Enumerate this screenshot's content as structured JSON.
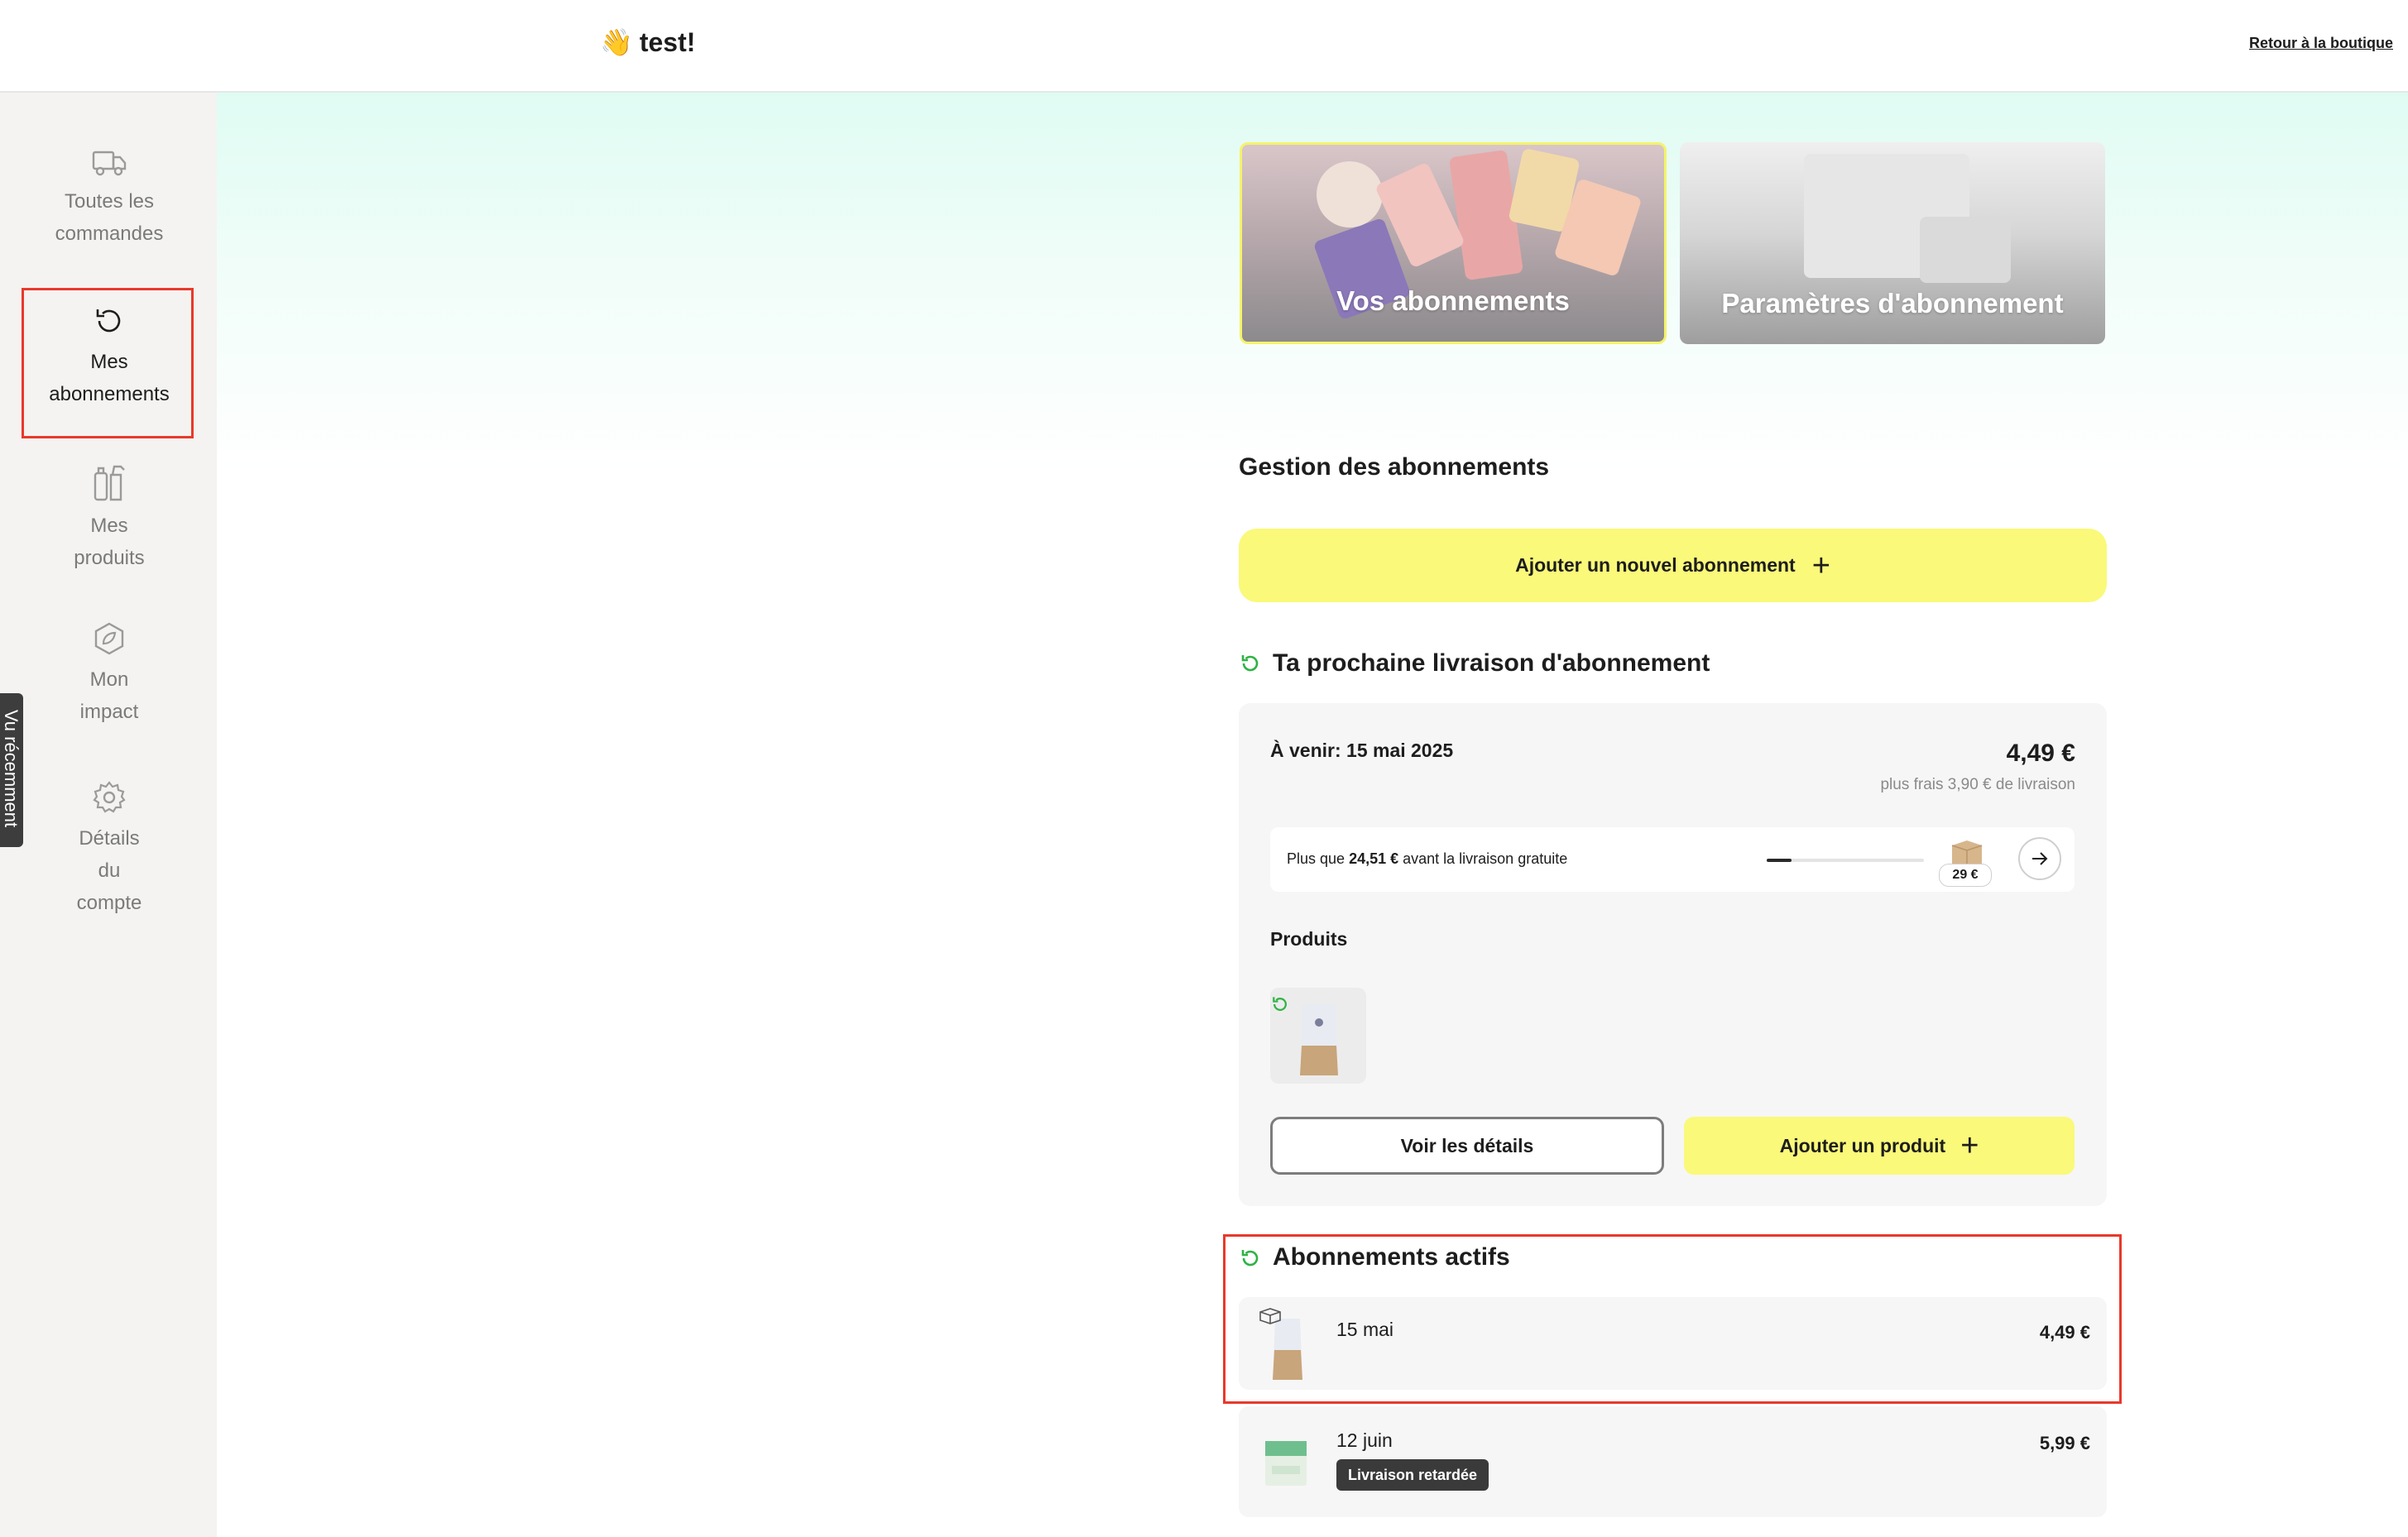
{
  "header": {
    "greeting_emoji": "👋",
    "greeting": "test!",
    "back_link": "Retour à la boutique"
  },
  "sidebar": {
    "items": [
      {
        "line1": "Toutes les",
        "line2": "commandes",
        "icon": "truck-icon"
      },
      {
        "line1": "Mes",
        "line2": "abonnements",
        "icon": "refresh-icon"
      },
      {
        "line1": "Mes",
        "line2": "produits",
        "icon": "spray-bottle-icon"
      },
      {
        "line1": "Mon",
        "line2": "impact",
        "icon": "leaf-icon"
      },
      {
        "line1": "Détails",
        "line2": "du",
        "line3": "compte",
        "icon": "gear-icon"
      }
    ],
    "side_tab": "Vu récemment"
  },
  "hero": {
    "card1": "Vos abonnements",
    "card2": "Paramètres d'abonnement"
  },
  "management": {
    "title": "Gestion des abonnements",
    "add_button": "Ajouter un nouvel abonnement"
  },
  "next_delivery": {
    "title": "Ta prochaine livraison d'abonnement",
    "upcoming": "À venir: 15 mai 2025",
    "price": "4,49 €",
    "fees": "plus frais 3,90 € de livraison",
    "shipping_prefix": "Plus que ",
    "shipping_amount": "24,51 €",
    "shipping_suffix": " avant la livraison gratuite",
    "shipping_progress": 0.16,
    "threshold": "29 €",
    "products_label": "Produits",
    "details_button": "Voir les détails",
    "add_product_button": "Ajouter un produit"
  },
  "active": {
    "title": "Abonnements actifs",
    "items": [
      {
        "date": "15 mai",
        "price": "4,49 €"
      },
      {
        "date": "12 juin",
        "price": "5,99 €",
        "badge": "Livraison retardée"
      }
    ]
  },
  "colors": {
    "accent_yellow": "#faf97a",
    "highlight_red": "#e8392b",
    "success_green": "#2fb344"
  }
}
